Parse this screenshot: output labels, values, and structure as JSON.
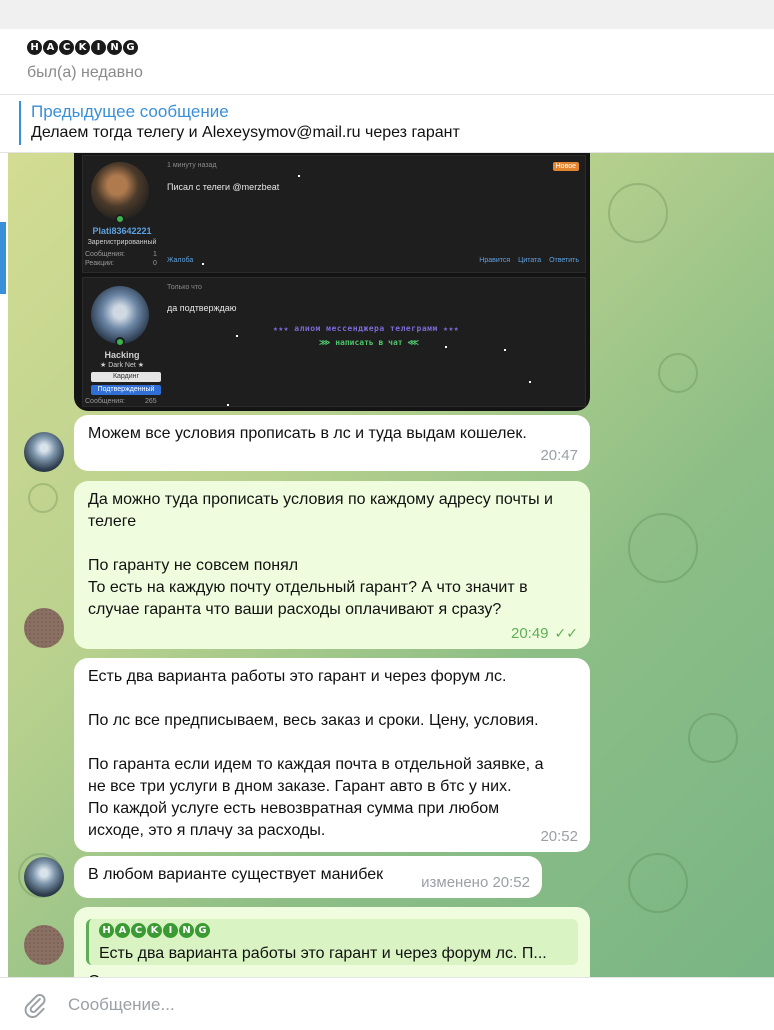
{
  "header": {
    "name_letters": [
      "H",
      "A",
      "C",
      "K",
      "I",
      "N",
      "G"
    ],
    "status": "был(а) недавно"
  },
  "pinned": {
    "title": "Предыдущее сообщение",
    "text": "Делаем тогда телегу и Alexeysymov@mail.ru через гарант"
  },
  "forum": {
    "post1": {
      "time": "1 минуту назад",
      "badge": "Новое",
      "username": "Plati83642221",
      "role": "Зарегистрированный",
      "messages_label": "Сообщения:",
      "messages_value": "1",
      "reactions_label": "Реакции:",
      "reactions_value": "0",
      "text": "Писал с телеги @merzbeat",
      "report": "Жалоба",
      "like": "Нравится",
      "quote": "Цитата",
      "reply": "Ответить"
    },
    "post2": {
      "time": "Только что",
      "username": "Hacking",
      "subtitle": "★ Dark Net ★",
      "badge1": "Кардинг",
      "badge2": "Подтвержденный",
      "messages_label": "Сообщения:",
      "messages_value": "265",
      "text": "да подтверждаю",
      "banner1": "★★★ алиом мессенджера телеграмм ★★★",
      "banner2": "⋙ написать в чат ⋘"
    }
  },
  "messages": [
    {
      "text": "Можем все условия прописать в лс и туда выдам кошелек.",
      "time": "20:47"
    },
    {
      "text": "Да можно туда прописать условия по каждому адресу почты и\nтелеге\n\nПо гаранту не совсем понял\nТо есть на каждую почту отдельный гарант? А что значит в\nслучае гаранта что ваши расходы оплачивают я сразу?",
      "time": "20:49",
      "checks": "✓✓"
    },
    {
      "text": "Есть два варианта работы это гарант и через форум лс.\n\nПо лс все предписываем, весь заказ и сроки. Цену, условия.\n\nПо гаранта если идем то каждая почта в отдельной заявке, а\nне все три услуги в дном заказе. Гарант авто в бтс у них.\nПо каждой услуге есть невозвратная сумма при любом\nисходе, это я плачу за расходы.",
      "time": "20:52"
    },
    {
      "text": "В любом варианте существует манибек",
      "time": "изменено 20:52"
    },
    {
      "quote_letters": [
        "H",
        "A",
        "C",
        "K",
        "I",
        "N",
        "G"
      ],
      "quote_text": "Есть два варианта работы это гарант и через форум лс.  П...",
      "text": "О"
    }
  ],
  "composer": {
    "placeholder": "Сообщение..."
  },
  "colors": {
    "accent": "#3a8fd9",
    "outgoing_bubble": "#effdde",
    "check": "#5fae57"
  }
}
